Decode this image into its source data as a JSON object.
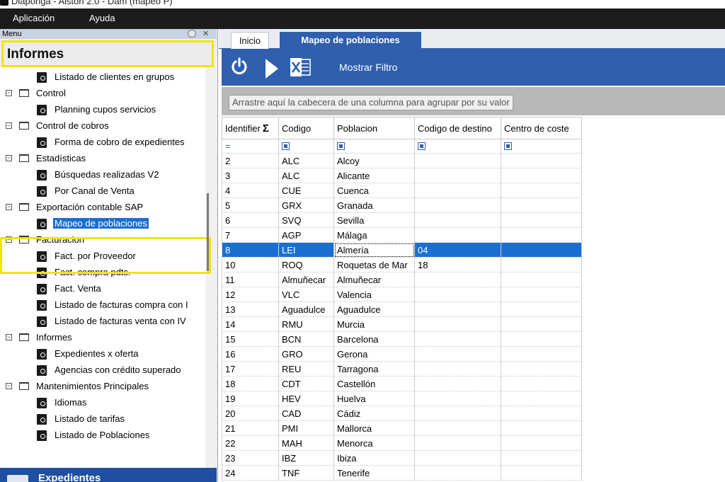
{
  "window": {
    "title": "Diaponga - Alston 2.0 - Dam (mapeo P)"
  },
  "menubar": {
    "items": [
      "Aplicación",
      "Ayuda"
    ]
  },
  "left_panel": {
    "header_label": "Menu",
    "section_title": "Informes",
    "tree": [
      {
        "type": "item",
        "label": "Listado de clientes en grupos"
      },
      {
        "type": "group",
        "label": "Control"
      },
      {
        "type": "item",
        "label": "Planning cupos servicios"
      },
      {
        "type": "group",
        "label": "Control de cobros"
      },
      {
        "type": "item",
        "label": "Forma de cobro de expedientes"
      },
      {
        "type": "group",
        "label": "Estadísticas"
      },
      {
        "type": "item",
        "label": "Búsquedas realizadas V2"
      },
      {
        "type": "item",
        "label": "Por Canal de Venta"
      },
      {
        "type": "group",
        "label": "Exportación contable SAP"
      },
      {
        "type": "item",
        "label": "Mapeo de poblaciones",
        "selected": true
      },
      {
        "type": "group",
        "label": "Facturacion"
      },
      {
        "type": "item",
        "label": "Fact. por Proveedor"
      },
      {
        "type": "item",
        "label": "Fact. compra pdts."
      },
      {
        "type": "item",
        "label": "Fact. Venta"
      },
      {
        "type": "item",
        "label": "Listado de facturas compra con I"
      },
      {
        "type": "item",
        "label": "Listado de facturas venta con IV"
      },
      {
        "type": "group",
        "label": "Informes"
      },
      {
        "type": "item",
        "label": "Expedientes x oferta"
      },
      {
        "type": "item",
        "label": "Agencias con crédito superado"
      },
      {
        "type": "group",
        "label": "Mantenimientos Principales"
      },
      {
        "type": "item",
        "label": "Idiomas"
      },
      {
        "type": "item",
        "label": "Listado de tarifas"
      },
      {
        "type": "item",
        "label": "Listado de Poblaciones"
      }
    ],
    "bottom_label": "Expedientes"
  },
  "tabs": [
    {
      "label": "Inicio",
      "active": false
    },
    {
      "label": "Mapeo de poblaciones",
      "active": true
    }
  ],
  "toolbar": {
    "filter_label": "Mostrar Filtro"
  },
  "grid": {
    "group_hint": "Arrastre aquí la cabecera de una columna para agrupar por su valor",
    "columns": [
      "Identifier",
      "Codigo",
      "Poblacion",
      "Codigo de destino",
      "Centro de coste"
    ],
    "filter_eq": "=",
    "rows": [
      [
        "2",
        "ALC",
        "Alcoy",
        "",
        ""
      ],
      [
        "3",
        "ALC",
        "Alicante",
        "",
        ""
      ],
      [
        "4",
        "CUE",
        "Cuenca",
        "",
        ""
      ],
      [
        "5",
        "GRX",
        "Granada",
        "",
        ""
      ],
      [
        "6",
        "SVQ",
        "Sevilla",
        "",
        ""
      ],
      [
        "7",
        "AGP",
        "Málaga",
        "",
        ""
      ],
      [
        "8",
        "LEI",
        "Almería",
        "04",
        ""
      ],
      [
        "10",
        "ROQ",
        "Roquetas de Mar",
        "18",
        ""
      ],
      [
        "11",
        "Almuñecar",
        "Almuñecar",
        "",
        ""
      ],
      [
        "12",
        "VLC",
        "Valencia",
        "",
        ""
      ],
      [
        "13",
        "Aguadulce",
        "Aguadulce",
        "",
        ""
      ],
      [
        "14",
        "RMU",
        "Murcia",
        "",
        ""
      ],
      [
        "15",
        "BCN",
        "Barcelona",
        "",
        ""
      ],
      [
        "16",
        "GRO",
        "Gerona",
        "",
        ""
      ],
      [
        "17",
        "REU",
        "Tarragona",
        "",
        ""
      ],
      [
        "18",
        "CDT",
        "Castellón",
        "",
        ""
      ],
      [
        "19",
        "HEV",
        "Huelva",
        "",
        ""
      ],
      [
        "20",
        "CAD",
        "Cádiz",
        "",
        ""
      ],
      [
        "21",
        "PMI",
        "Mallorca",
        "",
        ""
      ],
      [
        "22",
        "MAH",
        "Menorca",
        "",
        ""
      ],
      [
        "23",
        "IBZ",
        "Ibiza",
        "",
        ""
      ],
      [
        "24",
        "TNF",
        "Tenerife",
        "",
        ""
      ]
    ],
    "selected_row": 6
  },
  "colors": {
    "accent": "#2f5fad",
    "selection": "#1b6fd1",
    "highlight": "#f2e500",
    "menubar": "#1c1c1c"
  },
  "icons": [
    "power-icon",
    "play-icon",
    "excel-icon",
    "folder-icon",
    "report-icon",
    "sigma-icon"
  ]
}
